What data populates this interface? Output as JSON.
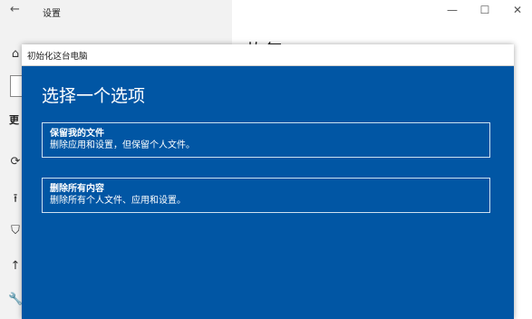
{
  "settings": {
    "title": "设置",
    "back_icon": "←",
    "window_controls": {
      "minimize": "—",
      "maximize": "☐",
      "close": "✕"
    },
    "heading_fragment": "更",
    "right_title_fragment": "恢复"
  },
  "dialog": {
    "title": "初始化这台电脑",
    "heading": "选择一个选项",
    "options": [
      {
        "title": "保留我的文件",
        "description": "删除应用和设置，但保留个人文件。"
      },
      {
        "title": "删除所有内容",
        "description": "删除所有个人文件、应用和设置。"
      }
    ]
  },
  "colors": {
    "dialog_background": "#0156a4",
    "option_border": "#cfe0f0"
  },
  "icons": [
    "back-icon",
    "home-icon",
    "sync-icon",
    "upload-icon",
    "shield-icon",
    "arrow-up-icon",
    "wrench-icon"
  ]
}
